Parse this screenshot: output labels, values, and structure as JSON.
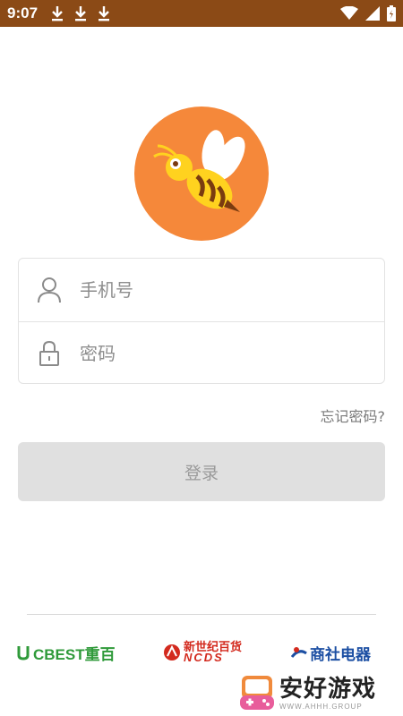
{
  "status_bar": {
    "time": "9:07",
    "icons": [
      "download-icon",
      "download-icon",
      "download-icon",
      "wifi-icon",
      "signal-icon",
      "battery-icon"
    ],
    "color": "#8b4a16"
  },
  "logo": {
    "icon": "bee-logo-icon",
    "accent": "#f5883a"
  },
  "login_form": {
    "phone_placeholder": "手机号",
    "password_placeholder": "密码",
    "phone_icon": "user-icon",
    "password_icon": "lock-icon"
  },
  "forgot_password_label": "忘记密码?",
  "login_button_label": "登录",
  "partners": {
    "cbest": "CBEST重百",
    "ncds_cn": "新世纪百货",
    "ncds_en": "NCDS",
    "shangshe": "商社电器"
  },
  "watermark": {
    "title": "安好游戏",
    "subtitle": "WWW.AHHH.GROUP"
  }
}
